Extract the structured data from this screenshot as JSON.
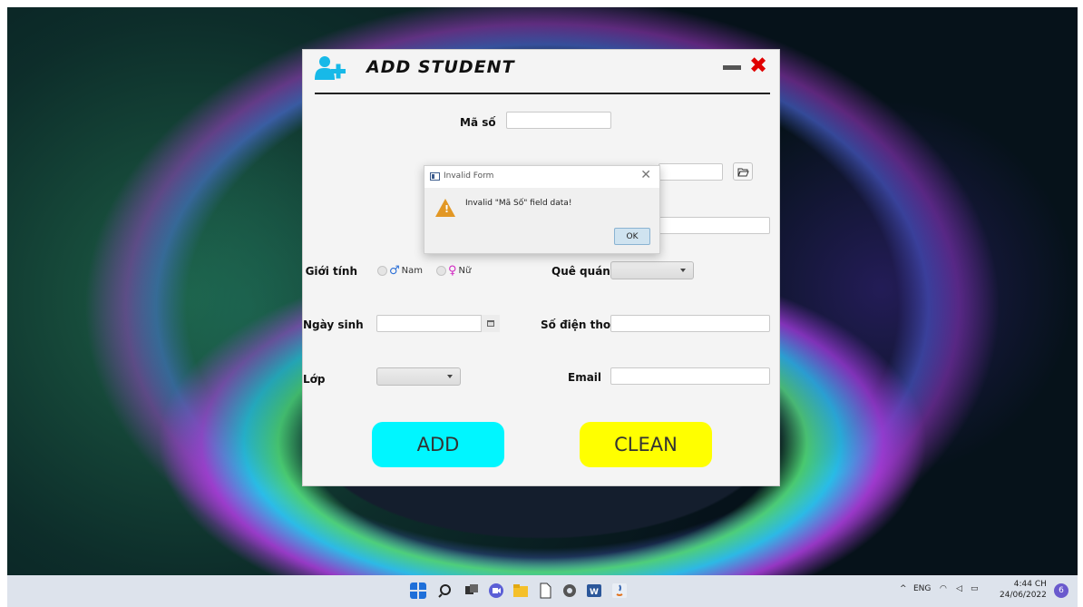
{
  "app": {
    "title": "ADD STUDENT",
    "fields": {
      "ma_so_label": "Mã số",
      "ma_so_value": "",
      "gioi_tinh_label": "Giới tính",
      "nam_label": "Nam",
      "nu_label": "Nữ",
      "que_quan_label": "Quê quán",
      "que_quan_value": "",
      "ngay_sinh_label": "Ngày sinh",
      "ngay_sinh_value": "",
      "so_dien_thoai_label": "Số điện thoại",
      "so_dien_thoai_value": "",
      "lop_label": "Lớp",
      "lop_value": "",
      "email_label": "Email",
      "email_value": ""
    },
    "buttons": {
      "add": "ADD",
      "clean": "CLEAN"
    },
    "colors": {
      "add": "#00f6ff",
      "clean": "#ffff00",
      "close": "#e00000",
      "title_icon": "#17b9e8"
    }
  },
  "dialog": {
    "title": "Invalid Form",
    "message": "Invalid \"Mã Số\" field data!",
    "ok": "OK",
    "icon": "warning-icon"
  },
  "taskbar": {
    "language": "ENG",
    "time": "4:44 CH",
    "date": "24/06/2022",
    "notifications": "6",
    "icons": [
      "windows-start-icon",
      "search-icon",
      "task-view-icon",
      "chat-icon",
      "file-explorer-icon",
      "document-icon",
      "settings-icon",
      "word-icon",
      "java-icon"
    ]
  }
}
